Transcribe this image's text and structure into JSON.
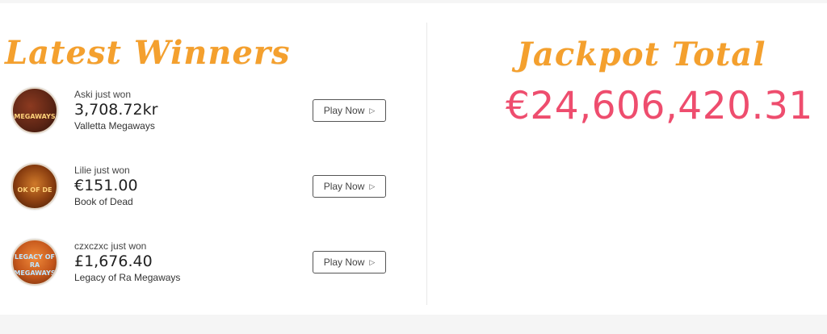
{
  "latest_winners": {
    "title": "Latest Winners",
    "items": [
      {
        "who": "Aski just won",
        "amount": "3,708.72kr",
        "game": "Valletta Megaways",
        "thumb_text": "MEGAWAYS",
        "button": "Play Now",
        "thumb_color": "#5a2414"
      },
      {
        "who": "Lilie just won",
        "amount": "€151.00",
        "game": "Book of Dead",
        "thumb_text": "OK OF DE",
        "button": "Play Now",
        "thumb_color": "#8a3e10"
      },
      {
        "who": "czxczxc just won",
        "amount": "£1,676.40",
        "game": "Legacy of Ra Megaways",
        "thumb_text": "LEGACY OF RA MEGAWAYS",
        "button": "Play Now",
        "thumb_color": "#c4561b"
      }
    ]
  },
  "jackpot": {
    "title": "Jackpot Total",
    "amount": "€24,606,420.31"
  },
  "colors": {
    "heading": "#f4a02e",
    "jackpot": "#ee4d6e"
  }
}
